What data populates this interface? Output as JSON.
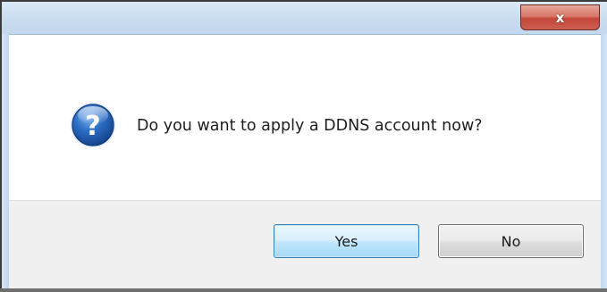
{
  "dialog": {
    "close_label": "x",
    "message": "Do you want to apply a DDNS account now?",
    "icon": "question-icon",
    "buttons": {
      "yes_label": "Yes",
      "no_label": "No"
    }
  },
  "colors": {
    "content_background": "#ffffff",
    "button_area_background": "#f0f0f0",
    "icon_blue": "#1e5fb4",
    "close_button_red": "#c4473a",
    "default_button_border": "#3c7fb1"
  }
}
